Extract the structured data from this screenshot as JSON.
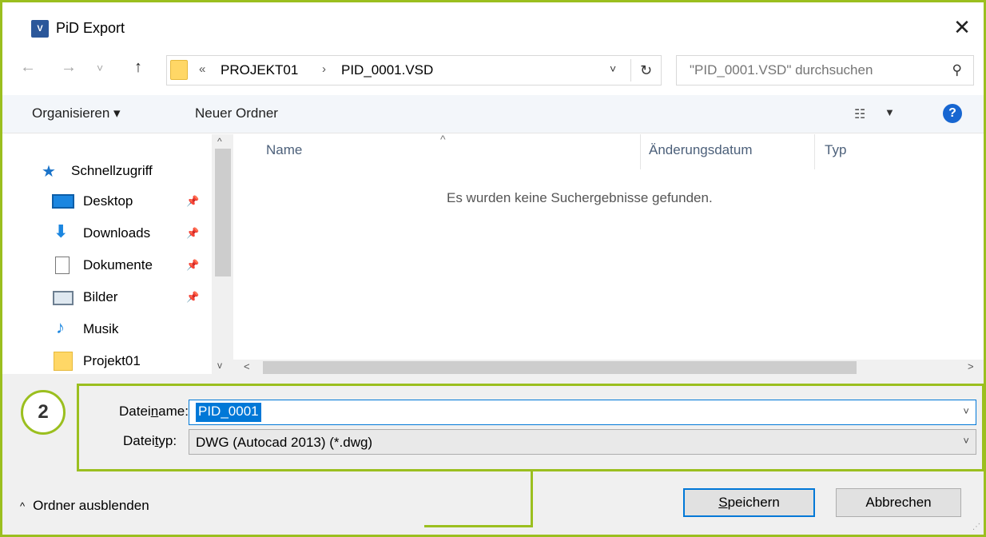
{
  "window": {
    "app_icon_text": "V",
    "title": "PiD Export",
    "close_glyph": "✕"
  },
  "navigation": {
    "back_glyph": "←",
    "forward_glyph": "→",
    "recent_glyph": "˅",
    "up_glyph": "↑",
    "address": {
      "overflow": "«",
      "crumbs": [
        "PROJEKT01",
        "PID_0001.VSD"
      ],
      "separator": "›",
      "dropdown_glyph": "˅",
      "refresh_glyph": "↻"
    },
    "search": {
      "placeholder": "\"PID_0001.VSD\" durchsuchen",
      "icon_glyph": "⚲"
    }
  },
  "toolbar": {
    "organize_label": "Organisieren ▾",
    "new_folder_label": "Neuer Ordner",
    "view_glyph": "☷",
    "view_drop_glyph": "▼",
    "help_glyph": "?"
  },
  "sidebar": {
    "quick_access": "Schnellzugriff",
    "pin_glyph": "📌",
    "items": [
      {
        "label": "Desktop",
        "pinned": true
      },
      {
        "label": "Downloads",
        "pinned": true
      },
      {
        "label": "Dokumente",
        "pinned": true
      },
      {
        "label": "Bilder",
        "pinned": true
      },
      {
        "label": "Musik",
        "pinned": false
      },
      {
        "label": "Projekt01",
        "pinned": false
      }
    ],
    "scroll_up_glyph": "^",
    "scroll_down_glyph": "v"
  },
  "file_list": {
    "columns": [
      "Name",
      "Änderungsdatum",
      "Typ"
    ],
    "sort_glyph": "^",
    "empty_message": "Es wurden keine Suchergebnisse gefunden.",
    "scroll_left_glyph": "<",
    "scroll_right_glyph": ">"
  },
  "save_panel": {
    "callout_number": "2",
    "filename_label_pre": "Datei",
    "filename_label_mnemonic": "n",
    "filename_label_post": "ame:",
    "filename_value": "PID_0001",
    "filetype_label_pre": "Datei",
    "filetype_label_mnemonic": "t",
    "filetype_label_post": "yp:",
    "filetype_value": "DWG (Autocad 2013) (*.dwg)",
    "dropdown_glyph": "˅"
  },
  "footer": {
    "hide_folders_chevron": "^",
    "hide_folders_label": "Ordner ausblenden",
    "save_mnemonic": "S",
    "save_rest": "peichern",
    "cancel_label": "Abbrechen",
    "grip_glyph": "⋰"
  },
  "colors": {
    "annotation_green": "#9bbf1f",
    "accent_blue": "#0078d7",
    "help_blue": "#1766d1",
    "toolbar_bg": "#f3f6fa",
    "panel_bg": "#f0f0f0"
  }
}
